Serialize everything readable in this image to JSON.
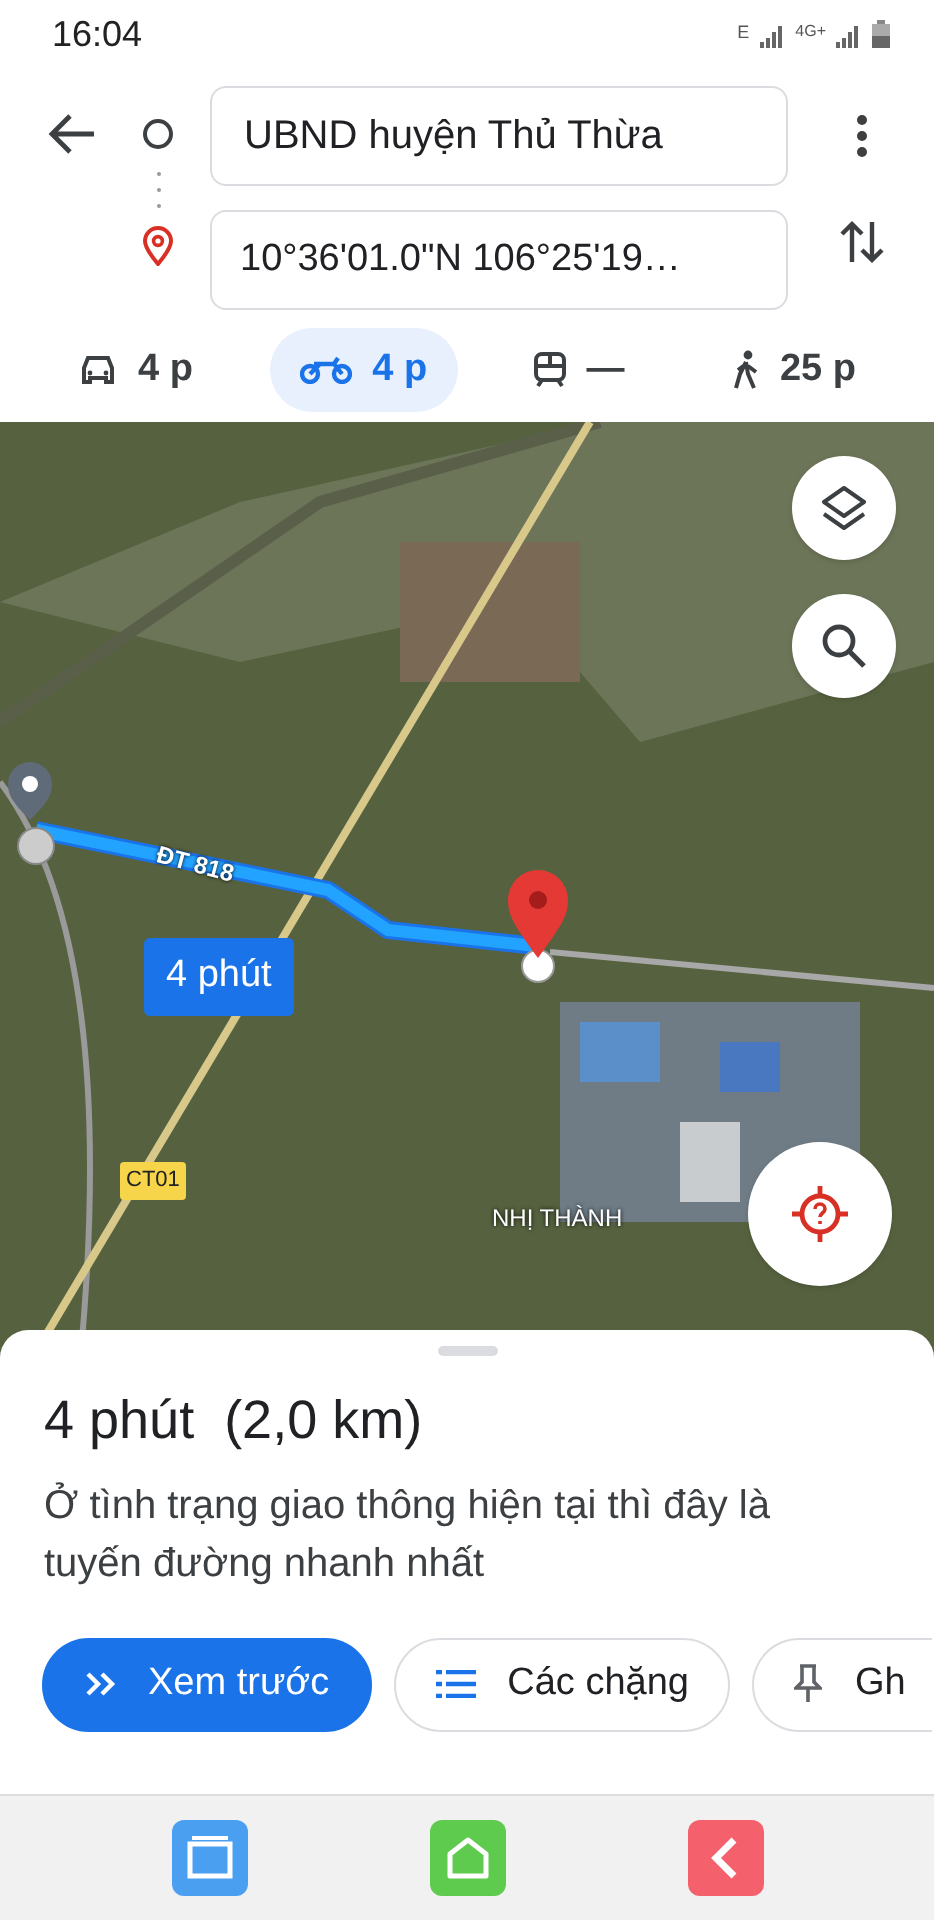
{
  "status_bar": {
    "time": "16:04",
    "network": "E",
    "network_2": "4G+"
  },
  "route": {
    "origin": "UBND huyện Thủ Thừa",
    "destination": "10°36'01.0\"N 106°25'19…"
  },
  "modes": [
    {
      "kind": "car",
      "time": "4 p",
      "selected": false
    },
    {
      "kind": "motorbike",
      "time": "4 p",
      "selected": true
    },
    {
      "kind": "transit",
      "time": "—",
      "selected": false
    },
    {
      "kind": "walk",
      "time": "25 p",
      "selected": false
    }
  ],
  "map": {
    "road_label": "ĐT 818",
    "duration_label": "4 phút",
    "highway_label": "CT01",
    "place_label": "NHỊ THÀNH"
  },
  "sheet": {
    "title": "4 phút  (2,0 km)",
    "description": "Ở tình trạng giao thông hiện tại thì đây là tuyến đường nhanh nhất",
    "actions": [
      {
        "kind": "preview",
        "label": "Xem trước",
        "primary": true
      },
      {
        "kind": "steps",
        "label": "Các chặng",
        "primary": false
      },
      {
        "kind": "pin",
        "label": "Gh",
        "primary": false
      }
    ]
  }
}
